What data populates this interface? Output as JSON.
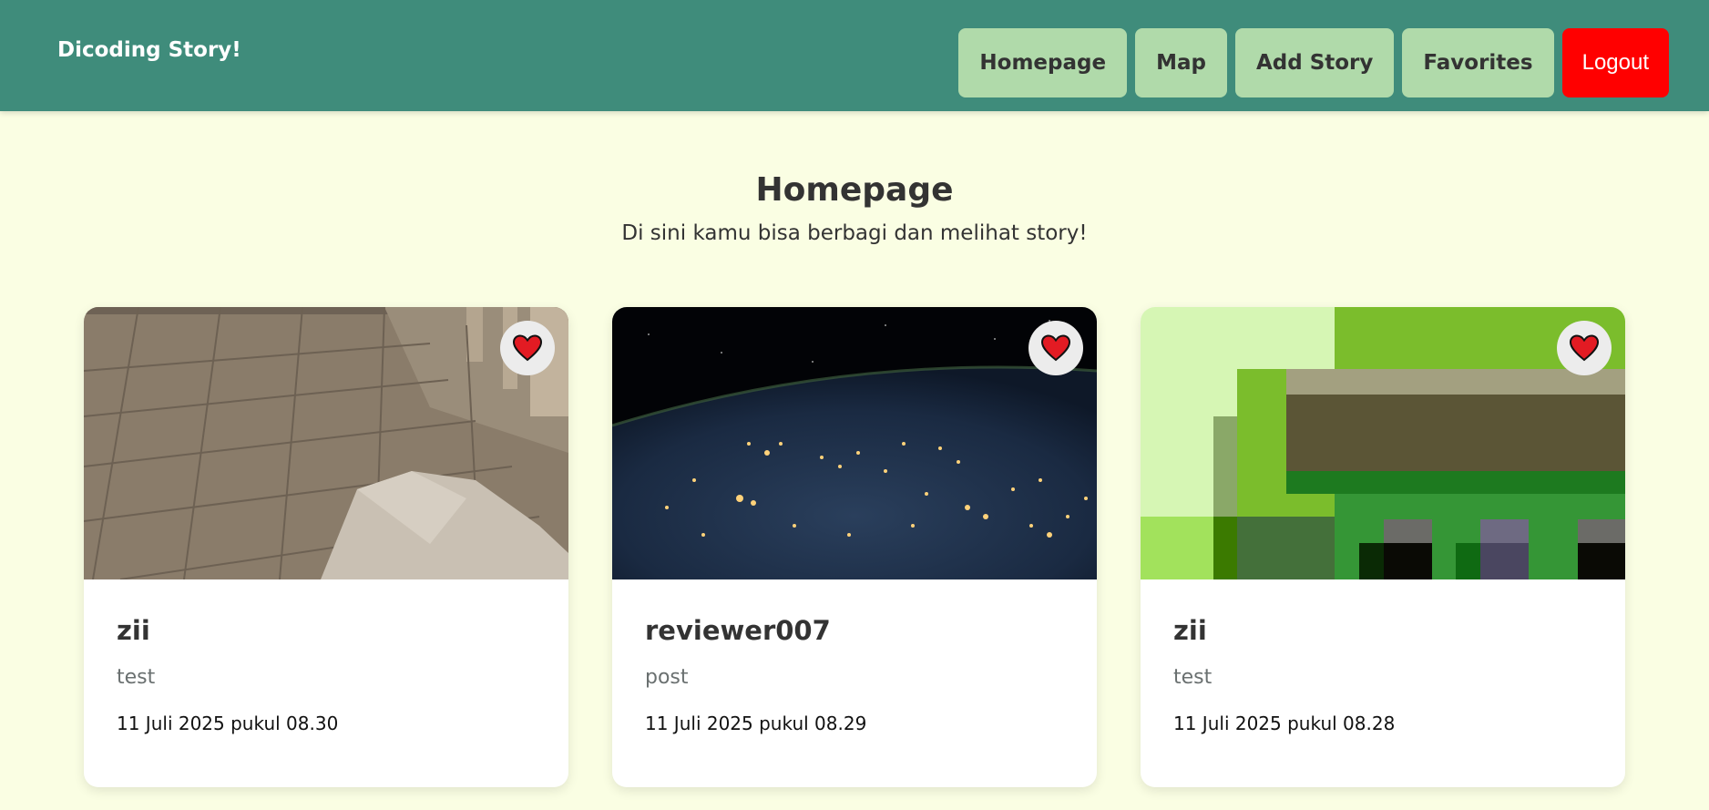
{
  "header": {
    "brand": "Dicoding Story!",
    "nav": [
      {
        "label": "Homepage"
      },
      {
        "label": "Map"
      },
      {
        "label": "Add Story"
      },
      {
        "label": "Favorites"
      },
      {
        "label": "Logout"
      }
    ]
  },
  "main": {
    "title": "Homepage",
    "subtitle": "Di sini kamu bisa berbagi dan melihat story!"
  },
  "stories": [
    {
      "name": "zii",
      "description": "test",
      "date": "11 Juli 2025 pukul 08.30",
      "image": "wooden-floor-photo",
      "favorite_icon": "heart-icon"
    },
    {
      "name": "reviewer007",
      "description": "post",
      "date": "11 Juli 2025 pukul 08.29",
      "image": "earth-at-night-photo",
      "favorite_icon": "heart-icon"
    },
    {
      "name": "zii",
      "description": "test",
      "date": "11 Juli 2025 pukul 08.28",
      "image": "pixelated-green-photo",
      "favorite_icon": "heart-icon"
    }
  ],
  "colors": {
    "header_bg": "#3f8c7b",
    "page_bg": "#fafee3",
    "nav_button_bg": "#b0daaa",
    "logout_bg": "#ff0000",
    "heart": "#e31b23"
  }
}
